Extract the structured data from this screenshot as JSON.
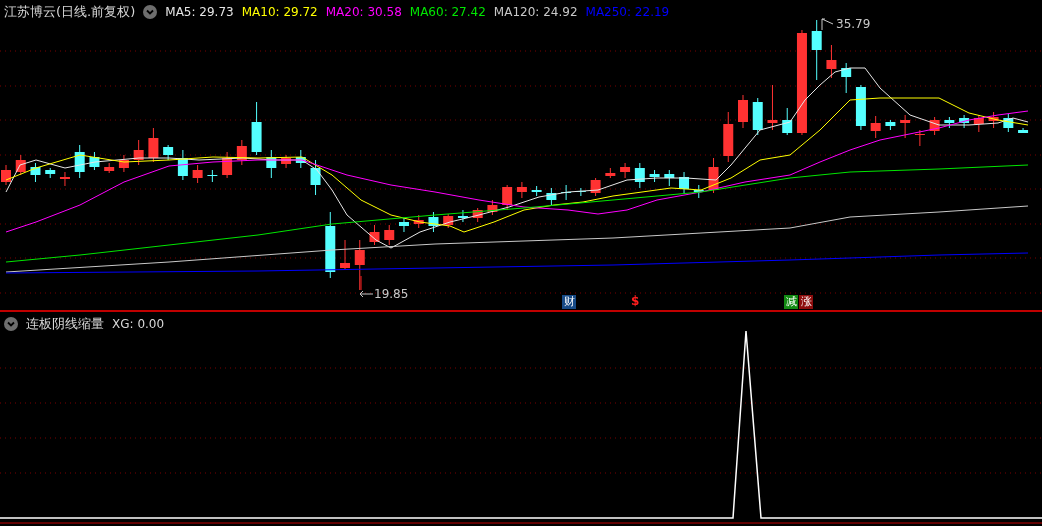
{
  "stock": {
    "title": "江苏博云(日线.前复权)",
    "moving_averages": [
      {
        "label": "MA5: 29.73",
        "color": "#e6e6e6"
      },
      {
        "label": "MA10: 29.72",
        "color": "#ffff00"
      },
      {
        "label": "MA20: 30.58",
        "color": "#ff00ff"
      },
      {
        "label": "MA60: 27.42",
        "color": "#00e600"
      },
      {
        "label": "MA120: 24.92",
        "color": "#c8c8c8"
      },
      {
        "label": "MA250: 22.19",
        "color": "#0000ff"
      }
    ]
  },
  "chart": {
    "high_label": "35.79",
    "low_label": "19.85",
    "markers": [
      {
        "kind": "badge",
        "text": "财",
        "color": "#174a86"
      },
      {
        "kind": "symbol",
        "text": "$",
        "color": "#ff1e1e"
      },
      {
        "kind": "badge",
        "text": "减",
        "color": "#128a12"
      },
      {
        "kind": "badge",
        "text": "涨",
        "color": "#8c0c0c"
      }
    ]
  },
  "indicator": {
    "title": "连板阴线缩量",
    "reading": "XG: 0.00"
  }
}
